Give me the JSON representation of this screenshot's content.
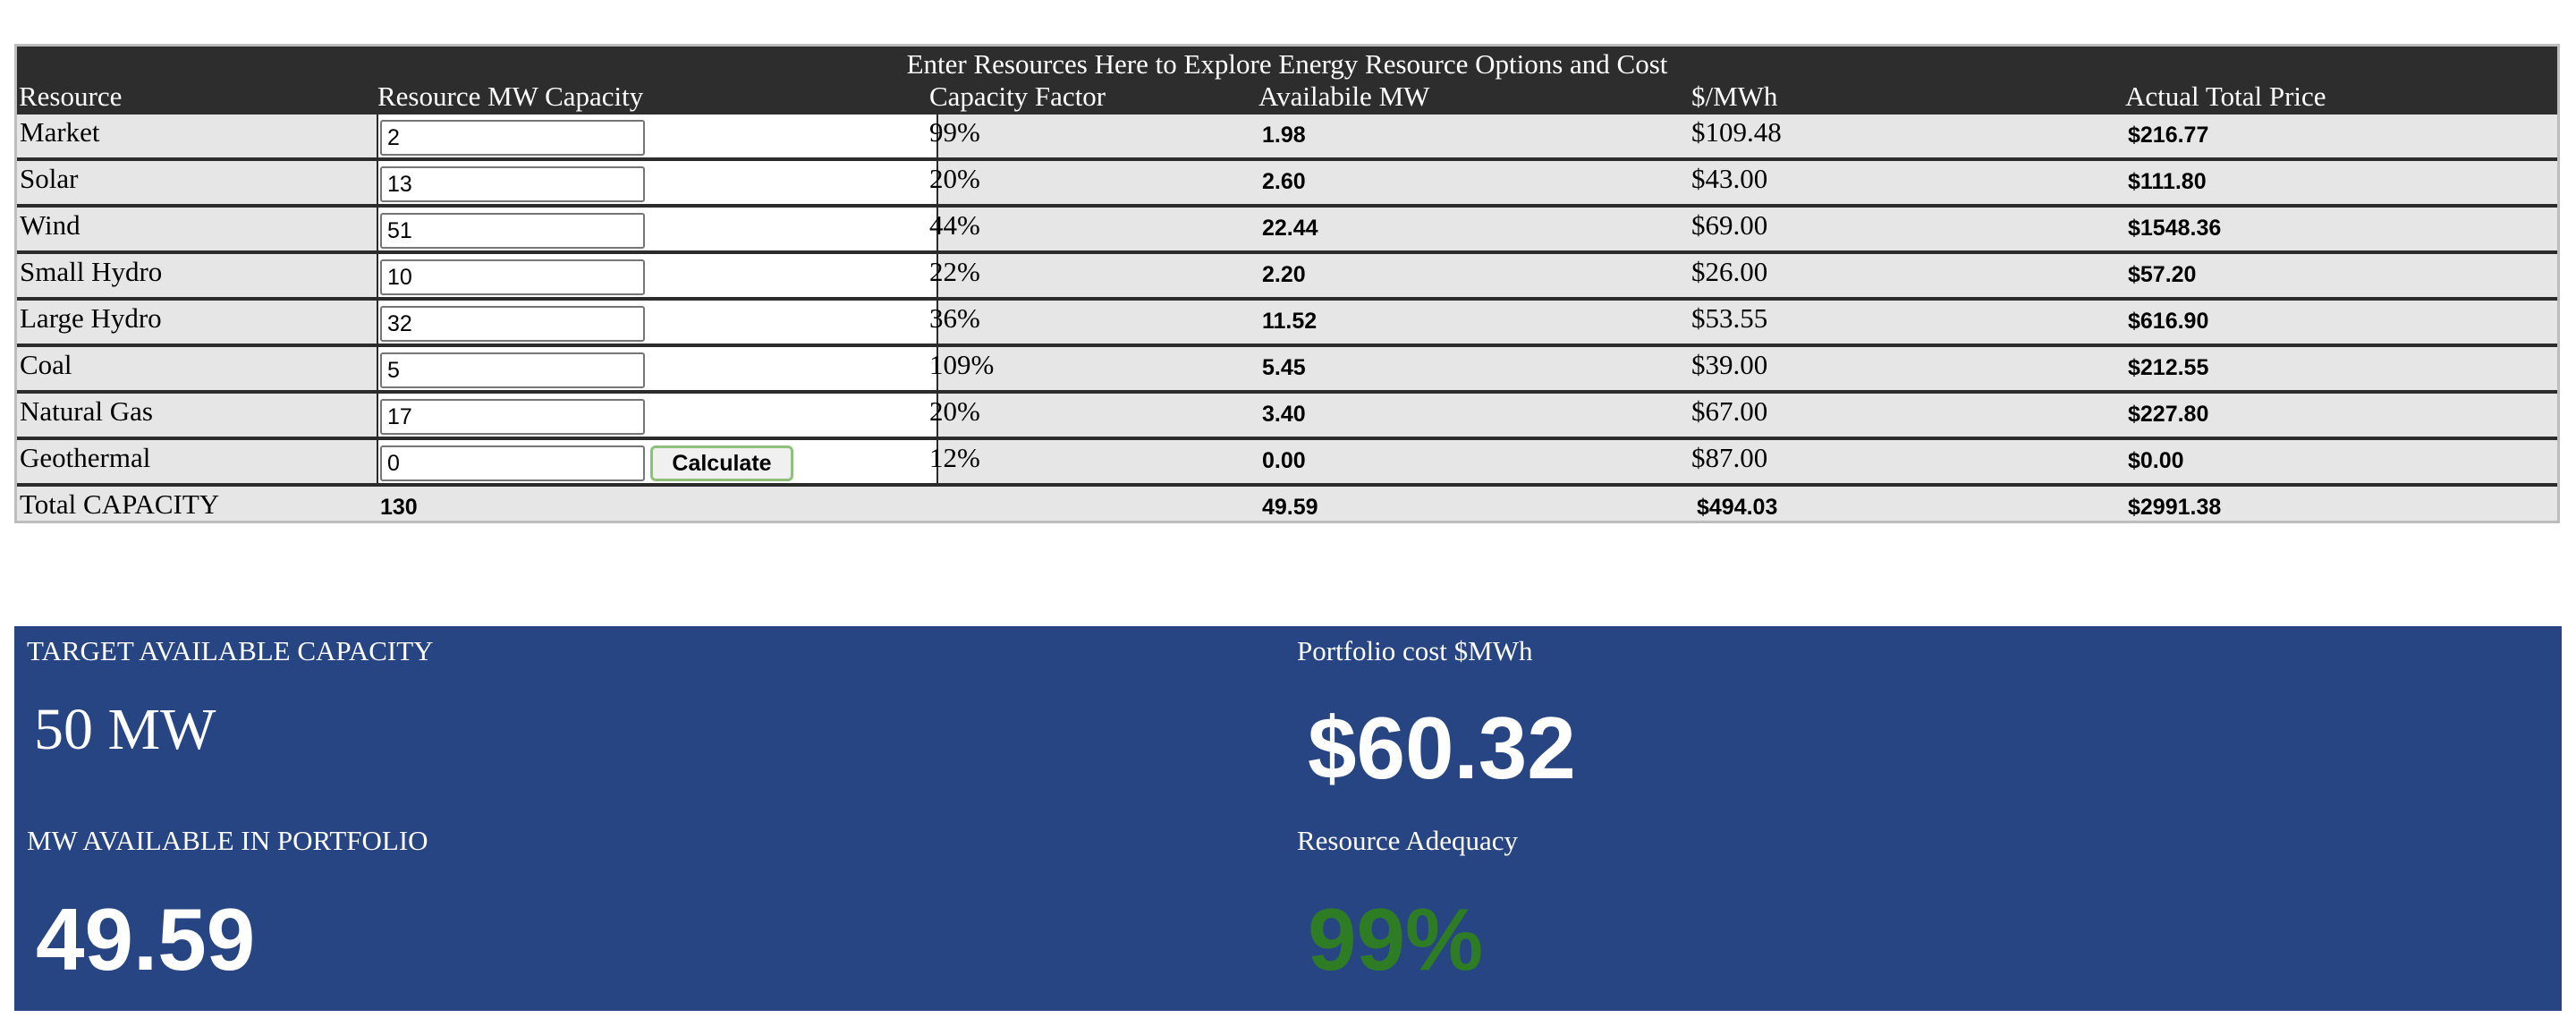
{
  "table": {
    "banner": "Enter Resources Here to Explore Energy Resource Options and Cost",
    "headers": {
      "resource": "Resource",
      "capacity": "Resource MW Capacity",
      "factor": "Capacity Factor",
      "available": "Availabile MW",
      "rate": "$/MWh",
      "total_price": "Actual Total Price"
    },
    "rows": [
      {
        "name": "Market",
        "capacity": "2",
        "factor": "99%",
        "available": "1.98",
        "rate": "$109.48",
        "total": "$216.77"
      },
      {
        "name": "Solar",
        "capacity": "13",
        "factor": "20%",
        "available": "2.60",
        "rate": "$43.00",
        "total": "$111.80"
      },
      {
        "name": "Wind",
        "capacity": "51",
        "factor": "44%",
        "available": "22.44",
        "rate": "$69.00",
        "total": "$1548.36"
      },
      {
        "name": "Small Hydro",
        "capacity": "10",
        "factor": "22%",
        "available": "2.20",
        "rate": "$26.00",
        "total": "$57.20"
      },
      {
        "name": "Large Hydro",
        "capacity": "32",
        "factor": "36%",
        "available": "11.52",
        "rate": "$53.55",
        "total": "$616.90"
      },
      {
        "name": "Coal",
        "capacity": "5",
        "factor": "109%",
        "available": "5.45",
        "rate": "$39.00",
        "total": "$212.55"
      },
      {
        "name": "Natural Gas",
        "capacity": "17",
        "factor": "20%",
        "available": "3.40",
        "rate": "$67.00",
        "total": "$227.80"
      },
      {
        "name": "Geothermal",
        "capacity": "0",
        "factor": "12%",
        "available": "0.00",
        "rate": "$87.00",
        "total": "$0.00"
      }
    ],
    "calculate_label": "Calculate",
    "totals": {
      "label": "Total CAPACITY",
      "capacity": "130",
      "available": "49.59",
      "rate": "$494.03",
      "total": "$2991.38"
    }
  },
  "dashboard": {
    "target_label": "TARGET AVAILABLE CAPACITY",
    "target_value": "50 MW",
    "portfolio_cost_label": "Portfolio cost $MWh",
    "portfolio_cost_value": "$60.32",
    "mw_available_label": "MW AVAILABLE IN PORTFOLIO",
    "mw_available_value": "49.59",
    "adequacy_label": "Resource Adequacy",
    "adequacy_value": "99%",
    "adequacy_color": "#2e7d25",
    "panel_color": "#274583"
  }
}
